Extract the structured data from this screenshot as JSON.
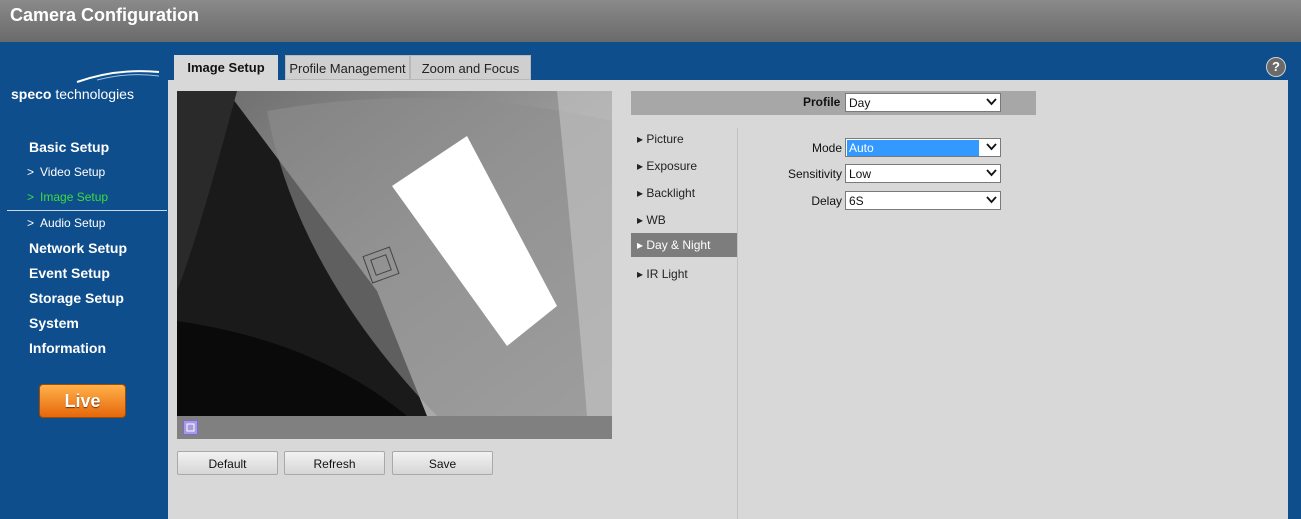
{
  "window": {
    "title": "Camera Configuration"
  },
  "logo": {
    "brand_bold": "speco",
    "brand_rest": " technologies"
  },
  "sidebar": {
    "sections": [
      {
        "label": "Basic Setup"
      },
      {
        "label": "Network Setup"
      },
      {
        "label": "Event Setup"
      },
      {
        "label": "Storage Setup"
      },
      {
        "label": "System"
      },
      {
        "label": "Information"
      }
    ],
    "basic_items": [
      {
        "label": "Video Setup",
        "chevron": ">"
      },
      {
        "label": "Image Setup",
        "chevron": ">"
      },
      {
        "label": "Audio Setup",
        "chevron": ">"
      }
    ],
    "live_label": "Live"
  },
  "tabs": [
    {
      "label": "Image Setup"
    },
    {
      "label": "Profile Management"
    },
    {
      "label": "Zoom and Focus"
    }
  ],
  "help_label": "?",
  "buttons": {
    "default_label": "Default",
    "refresh_label": "Refresh",
    "save_label": "Save"
  },
  "profile": {
    "label": "Profile",
    "value": "Day"
  },
  "menu": [
    {
      "label": "Picture"
    },
    {
      "label": "Exposure"
    },
    {
      "label": "Backlight"
    },
    {
      "label": "WB"
    },
    {
      "label": "Day & Night"
    },
    {
      "label": "IR Light"
    }
  ],
  "menu_bullet": "▸",
  "settings": {
    "mode_label": "Mode",
    "mode_value": "Auto",
    "sensitivity_label": "Sensitivity",
    "sensitivity_value": "Low",
    "delay_label": "Delay",
    "delay_value": "6S"
  },
  "colors": {
    "accent_blue": "#0f4e8d",
    "active_green": "#3ddc3d",
    "live_orange": "#e6670b"
  }
}
